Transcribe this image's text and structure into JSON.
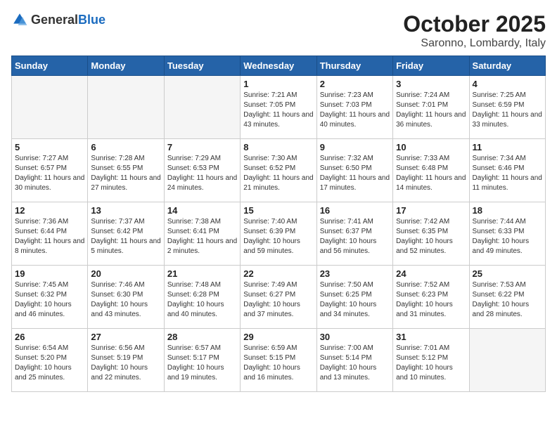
{
  "logo": {
    "text_general": "General",
    "text_blue": "Blue"
  },
  "header": {
    "month": "October 2025",
    "location": "Saronno, Lombardy, Italy"
  },
  "weekdays": [
    "Sunday",
    "Monday",
    "Tuesday",
    "Wednesday",
    "Thursday",
    "Friday",
    "Saturday"
  ],
  "weeks": [
    [
      {
        "day": "",
        "info": ""
      },
      {
        "day": "",
        "info": ""
      },
      {
        "day": "",
        "info": ""
      },
      {
        "day": "1",
        "info": "Sunrise: 7:21 AM\nSunset: 7:05 PM\nDaylight: 11 hours\nand 43 minutes."
      },
      {
        "day": "2",
        "info": "Sunrise: 7:23 AM\nSunset: 7:03 PM\nDaylight: 11 hours\nand 40 minutes."
      },
      {
        "day": "3",
        "info": "Sunrise: 7:24 AM\nSunset: 7:01 PM\nDaylight: 11 hours\nand 36 minutes."
      },
      {
        "day": "4",
        "info": "Sunrise: 7:25 AM\nSunset: 6:59 PM\nDaylight: 11 hours\nand 33 minutes."
      }
    ],
    [
      {
        "day": "5",
        "info": "Sunrise: 7:27 AM\nSunset: 6:57 PM\nDaylight: 11 hours\nand 30 minutes."
      },
      {
        "day": "6",
        "info": "Sunrise: 7:28 AM\nSunset: 6:55 PM\nDaylight: 11 hours\nand 27 minutes."
      },
      {
        "day": "7",
        "info": "Sunrise: 7:29 AM\nSunset: 6:53 PM\nDaylight: 11 hours\nand 24 minutes."
      },
      {
        "day": "8",
        "info": "Sunrise: 7:30 AM\nSunset: 6:52 PM\nDaylight: 11 hours\nand 21 minutes."
      },
      {
        "day": "9",
        "info": "Sunrise: 7:32 AM\nSunset: 6:50 PM\nDaylight: 11 hours\nand 17 minutes."
      },
      {
        "day": "10",
        "info": "Sunrise: 7:33 AM\nSunset: 6:48 PM\nDaylight: 11 hours\nand 14 minutes."
      },
      {
        "day": "11",
        "info": "Sunrise: 7:34 AM\nSunset: 6:46 PM\nDaylight: 11 hours\nand 11 minutes."
      }
    ],
    [
      {
        "day": "12",
        "info": "Sunrise: 7:36 AM\nSunset: 6:44 PM\nDaylight: 11 hours\nand 8 minutes."
      },
      {
        "day": "13",
        "info": "Sunrise: 7:37 AM\nSunset: 6:42 PM\nDaylight: 11 hours\nand 5 minutes."
      },
      {
        "day": "14",
        "info": "Sunrise: 7:38 AM\nSunset: 6:41 PM\nDaylight: 11 hours\nand 2 minutes."
      },
      {
        "day": "15",
        "info": "Sunrise: 7:40 AM\nSunset: 6:39 PM\nDaylight: 10 hours\nand 59 minutes."
      },
      {
        "day": "16",
        "info": "Sunrise: 7:41 AM\nSunset: 6:37 PM\nDaylight: 10 hours\nand 56 minutes."
      },
      {
        "day": "17",
        "info": "Sunrise: 7:42 AM\nSunset: 6:35 PM\nDaylight: 10 hours\nand 52 minutes."
      },
      {
        "day": "18",
        "info": "Sunrise: 7:44 AM\nSunset: 6:33 PM\nDaylight: 10 hours\nand 49 minutes."
      }
    ],
    [
      {
        "day": "19",
        "info": "Sunrise: 7:45 AM\nSunset: 6:32 PM\nDaylight: 10 hours\nand 46 minutes."
      },
      {
        "day": "20",
        "info": "Sunrise: 7:46 AM\nSunset: 6:30 PM\nDaylight: 10 hours\nand 43 minutes."
      },
      {
        "day": "21",
        "info": "Sunrise: 7:48 AM\nSunset: 6:28 PM\nDaylight: 10 hours\nand 40 minutes."
      },
      {
        "day": "22",
        "info": "Sunrise: 7:49 AM\nSunset: 6:27 PM\nDaylight: 10 hours\nand 37 minutes."
      },
      {
        "day": "23",
        "info": "Sunrise: 7:50 AM\nSunset: 6:25 PM\nDaylight: 10 hours\nand 34 minutes."
      },
      {
        "day": "24",
        "info": "Sunrise: 7:52 AM\nSunset: 6:23 PM\nDaylight: 10 hours\nand 31 minutes."
      },
      {
        "day": "25",
        "info": "Sunrise: 7:53 AM\nSunset: 6:22 PM\nDaylight: 10 hours\nand 28 minutes."
      }
    ],
    [
      {
        "day": "26",
        "info": "Sunrise: 6:54 AM\nSunset: 5:20 PM\nDaylight: 10 hours\nand 25 minutes."
      },
      {
        "day": "27",
        "info": "Sunrise: 6:56 AM\nSunset: 5:19 PM\nDaylight: 10 hours\nand 22 minutes."
      },
      {
        "day": "28",
        "info": "Sunrise: 6:57 AM\nSunset: 5:17 PM\nDaylight: 10 hours\nand 19 minutes."
      },
      {
        "day": "29",
        "info": "Sunrise: 6:59 AM\nSunset: 5:15 PM\nDaylight: 10 hours\nand 16 minutes."
      },
      {
        "day": "30",
        "info": "Sunrise: 7:00 AM\nSunset: 5:14 PM\nDaylight: 10 hours\nand 13 minutes."
      },
      {
        "day": "31",
        "info": "Sunrise: 7:01 AM\nSunset: 5:12 PM\nDaylight: 10 hours\nand 10 minutes."
      },
      {
        "day": "",
        "info": ""
      }
    ]
  ]
}
